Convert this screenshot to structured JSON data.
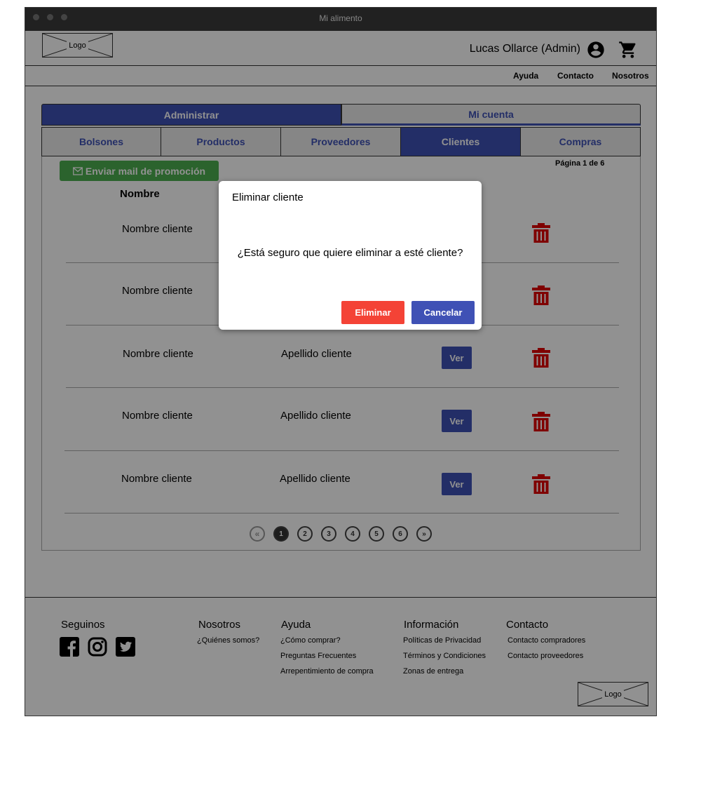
{
  "window": {
    "title": "Mi alimento"
  },
  "header": {
    "logo": "Logo",
    "user": "Lucas Ollarce (Admin)",
    "user_icon": "account-circle-icon",
    "cart_icon": "cart-icon"
  },
  "nav": {
    "items": [
      "Ayuda",
      "Contacto",
      "Nosotros"
    ]
  },
  "tabs_top": [
    {
      "label": "Administrar",
      "active": true
    },
    {
      "label": "Mi cuenta",
      "active": false
    }
  ],
  "tabs_admin": [
    {
      "label": "Bolsones",
      "active": false
    },
    {
      "label": "Productos",
      "active": false
    },
    {
      "label": "Proveedores",
      "active": false
    },
    {
      "label": "Clientes",
      "active": true
    },
    {
      "label": "Compras",
      "active": false
    }
  ],
  "toolbar": {
    "mail_button": "Enviar mail de promoción",
    "mail_icon": "envelope-icon",
    "page_info": "Página 1 de 6"
  },
  "table": {
    "columns": [
      "Nombre"
    ],
    "rows": [
      {
        "nombre": "Nombre cliente",
        "apellido": "",
        "action": ""
      },
      {
        "nombre": "Nombre cliente",
        "apellido": "",
        "action": ""
      },
      {
        "nombre": "Nombre cliente",
        "apellido": "Apellido cliente",
        "action": "Ver"
      },
      {
        "nombre": "Nombre cliente",
        "apellido": "Apellido cliente",
        "action": "Ver"
      },
      {
        "nombre": "Nombre cliente",
        "apellido": "Apellido cliente",
        "action": "Ver"
      }
    ]
  },
  "pagination": {
    "prev": "«",
    "pages": [
      "1",
      "2",
      "3",
      "4",
      "5",
      "6"
    ],
    "next": "»",
    "current": "1"
  },
  "footer": {
    "seguinos": "Seguinos",
    "social_icons": [
      "facebook-icon",
      "instagram-icon",
      "twitter-icon"
    ],
    "nosotros": {
      "title": "Nosotros",
      "links": [
        "¿Quiénes somos?"
      ]
    },
    "ayuda": {
      "title": "Ayuda",
      "links": [
        "¿Cómo comprar?",
        "Preguntas Frecuentes",
        "Arrepentimiento de compra"
      ]
    },
    "informacion": {
      "title": "Información",
      "links": [
        "Políticas de Privacidad",
        "Términos y Condiciones",
        "Zonas de entrega"
      ]
    },
    "contacto": {
      "title": "Contacto",
      "links": [
        "Contacto compradores",
        "Contacto proveedores"
      ]
    },
    "logo": "Logo"
  },
  "modal": {
    "title": "Eliminar cliente",
    "message": "¿Está seguro que quiere eliminar a esté cliente?",
    "confirm": "Eliminar",
    "cancel": "Cancelar"
  },
  "colors": {
    "primary": "#3f51b5",
    "danger": "#f44336",
    "success": "#4caf50",
    "trash": "#e00000"
  }
}
